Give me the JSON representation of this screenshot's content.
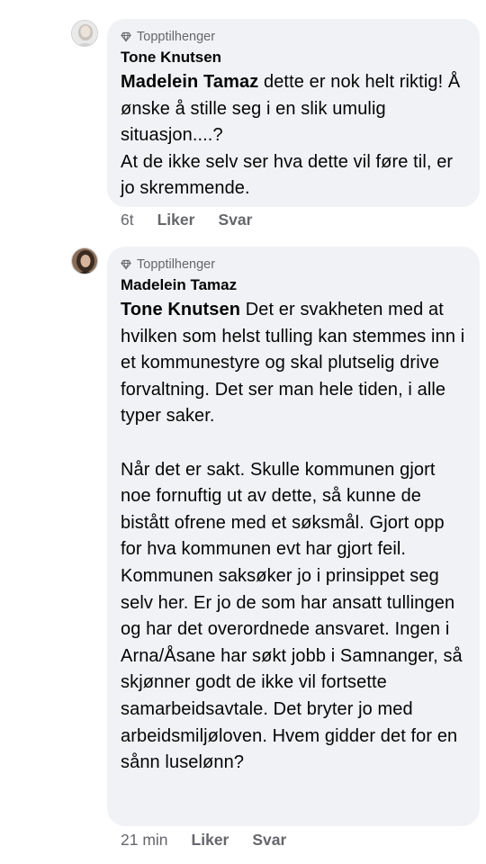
{
  "comments": [
    {
      "badge": "Topptilhenger",
      "author": "Tone Knutsen",
      "mention": "Madelein Tamaz",
      "paragraphs": [
        "dette er nok helt riktig! Å ønske å stille seg i en slik umulig situasjon....?",
        "At de ikke selv ser hva dette vil føre til, er jo skremmende."
      ],
      "time": "6t",
      "like_label": "Liker",
      "reply_label": "Svar"
    },
    {
      "badge": "Topptilhenger",
      "author": "Madelein Tamaz",
      "mention": "Tone Knutsen",
      "paragraphs": [
        "Det er svakheten med at hvilken som helst tulling kan stemmes inn i et kommunestyre og skal plutselig drive forvaltning. Det ser man hele tiden, i alle typer saker.",
        "Når det er sakt. Skulle kommunen gjort noe fornuftig ut av dette, så kunne de bistått ofrene med et søksmål. Gjort opp for hva kommunen evt har gjort feil. Kommunen saksøker jo i prinsippet seg selv her. Er jo de som har ansatt tullingen og har det overordnede ansvaret. Ingen i Arna/Åsane har søkt jobb i Samnanger, så skjønner godt de ikke vil fortsette samarbeidsavtale. Det bryter jo med arbeidsmiljøloven. Hvem gidder det for en sånn luselønn?"
      ],
      "time": "21 min",
      "like_label": "Liker",
      "reply_label": "Svar"
    }
  ],
  "icons": {
    "badge": "top-fan-diamond-icon"
  },
  "colors": {
    "bubble": "#f0f2f5",
    "secondary_text": "#65676b",
    "text": "#050505"
  }
}
